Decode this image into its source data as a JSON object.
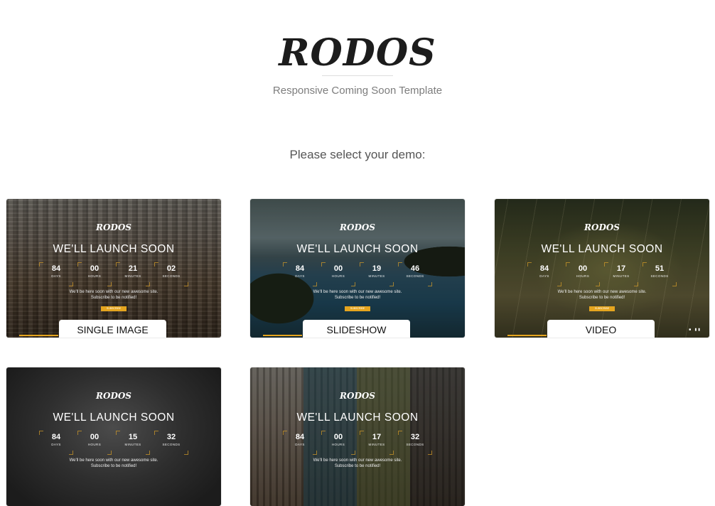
{
  "header": {
    "logo": "RODOS",
    "tagline": "Responsive Coming Soon Template"
  },
  "prompt": "Please select your demo:",
  "preview": {
    "brand": "RODOS",
    "headline": "WE'LL LAUNCH SOON",
    "text_line1": "We'll be here soon with our new awesome site.",
    "text_line2": "Subscribe to be notified!",
    "cta": "SUBSCRIBE",
    "units": [
      "DAYS",
      "HOURS",
      "MINUTES",
      "SECONDS"
    ]
  },
  "demos": [
    {
      "label": "SINGLE IMAGE",
      "background": "city",
      "counter": [
        "84",
        "00",
        "21",
        "02"
      ]
    },
    {
      "label": "SLIDESHOW",
      "background": "lake",
      "counter": [
        "84",
        "00",
        "19",
        "46"
      ]
    },
    {
      "label": "VIDEO",
      "background": "grass",
      "counter": [
        "84",
        "00",
        "17",
        "51"
      ],
      "controls": "■ ▮▮"
    },
    {
      "label": "",
      "background": "dark",
      "counter": [
        "84",
        "00",
        "15",
        "32"
      ]
    },
    {
      "label": "",
      "background": "mixed",
      "counter": [
        "84",
        "00",
        "17",
        "32"
      ]
    }
  ],
  "colors": {
    "accent": "#e5a51f",
    "text": "#1c1c1c",
    "muted": "#7d7d7d"
  }
}
